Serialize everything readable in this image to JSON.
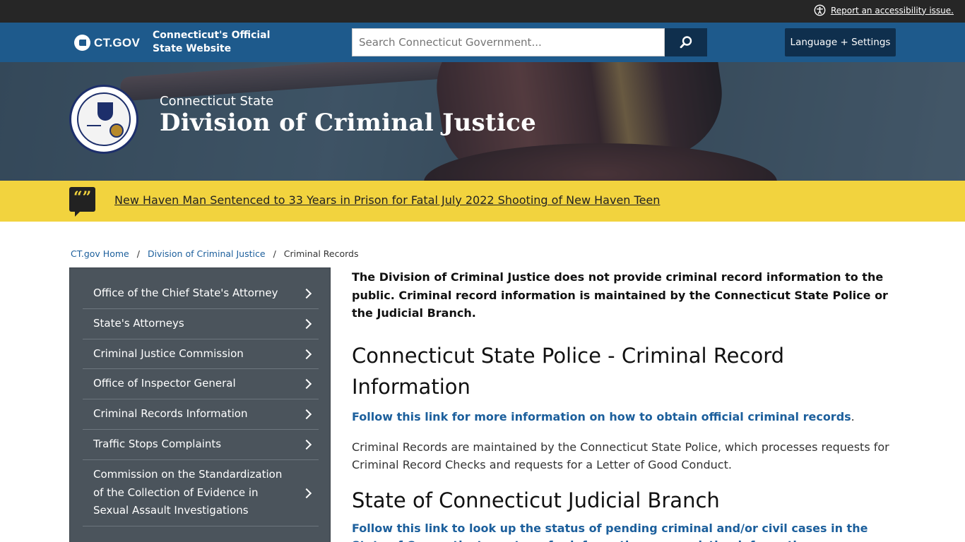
{
  "utility": {
    "accessibility_link": "Report an accessibility issue."
  },
  "header": {
    "logo_text": "CT.GOV",
    "official_line1": "Connecticut's Official",
    "official_line2": "State Website",
    "search_placeholder": "Search Connecticut Government...",
    "language_button": "Language + Settings"
  },
  "agency": {
    "subtitle": "Connecticut State",
    "title": "Division of Criminal Justice"
  },
  "alert": {
    "icon_glyph": "“”",
    "text": "New Haven Man Sentenced to 33 Years in Prison for Fatal July 2022 Shooting of New Haven Teen"
  },
  "breadcrumb": {
    "home": "CT.gov Home",
    "separator": "/",
    "agency": "Division of Criminal Justice",
    "current": "Criminal Records"
  },
  "sidebar": {
    "items": [
      {
        "label": "Office of the Chief State's Attorney"
      },
      {
        "label": "State's Attorneys"
      },
      {
        "label": "Criminal Justice Commission"
      },
      {
        "label": "Office of Inspector General"
      },
      {
        "label": "Criminal Records Information"
      },
      {
        "label": "Traffic Stops Complaints"
      },
      {
        "label": "Commission on the Standardization of the Collection of Evidence in Sexual Assault Investigations"
      }
    ]
  },
  "content": {
    "lede": "The Division of Criminal Justice does not provide criminal record information to the public. Criminal record information is maintained by the Connecticut State Police or the Judicial Branch.",
    "section1_heading": "Connecticut State Police - Criminal Record Information",
    "section1_link": "Follow this link for more information on how to obtain official criminal records",
    "section1_link_suffix": ".",
    "section1_body": "Criminal Records are maintained by the Connecticut State Police, which processes requests for Criminal Record Checks and requests for a Letter of Good Conduct.",
    "section2_heading": "State of Connecticut Judicial Branch",
    "section2_link": "Follow this link to look up the status of pending criminal and/or civil cases in the State of Connecticut courts or for information on conviction information."
  },
  "colors": {
    "utility_bg": "#262626",
    "header_bg": "#1e5a8c",
    "button_dark": "#0f2f4d",
    "alert_bg": "#f2d33e",
    "sidebar_bg": "#4b545c",
    "link": "#1c5f9c"
  }
}
